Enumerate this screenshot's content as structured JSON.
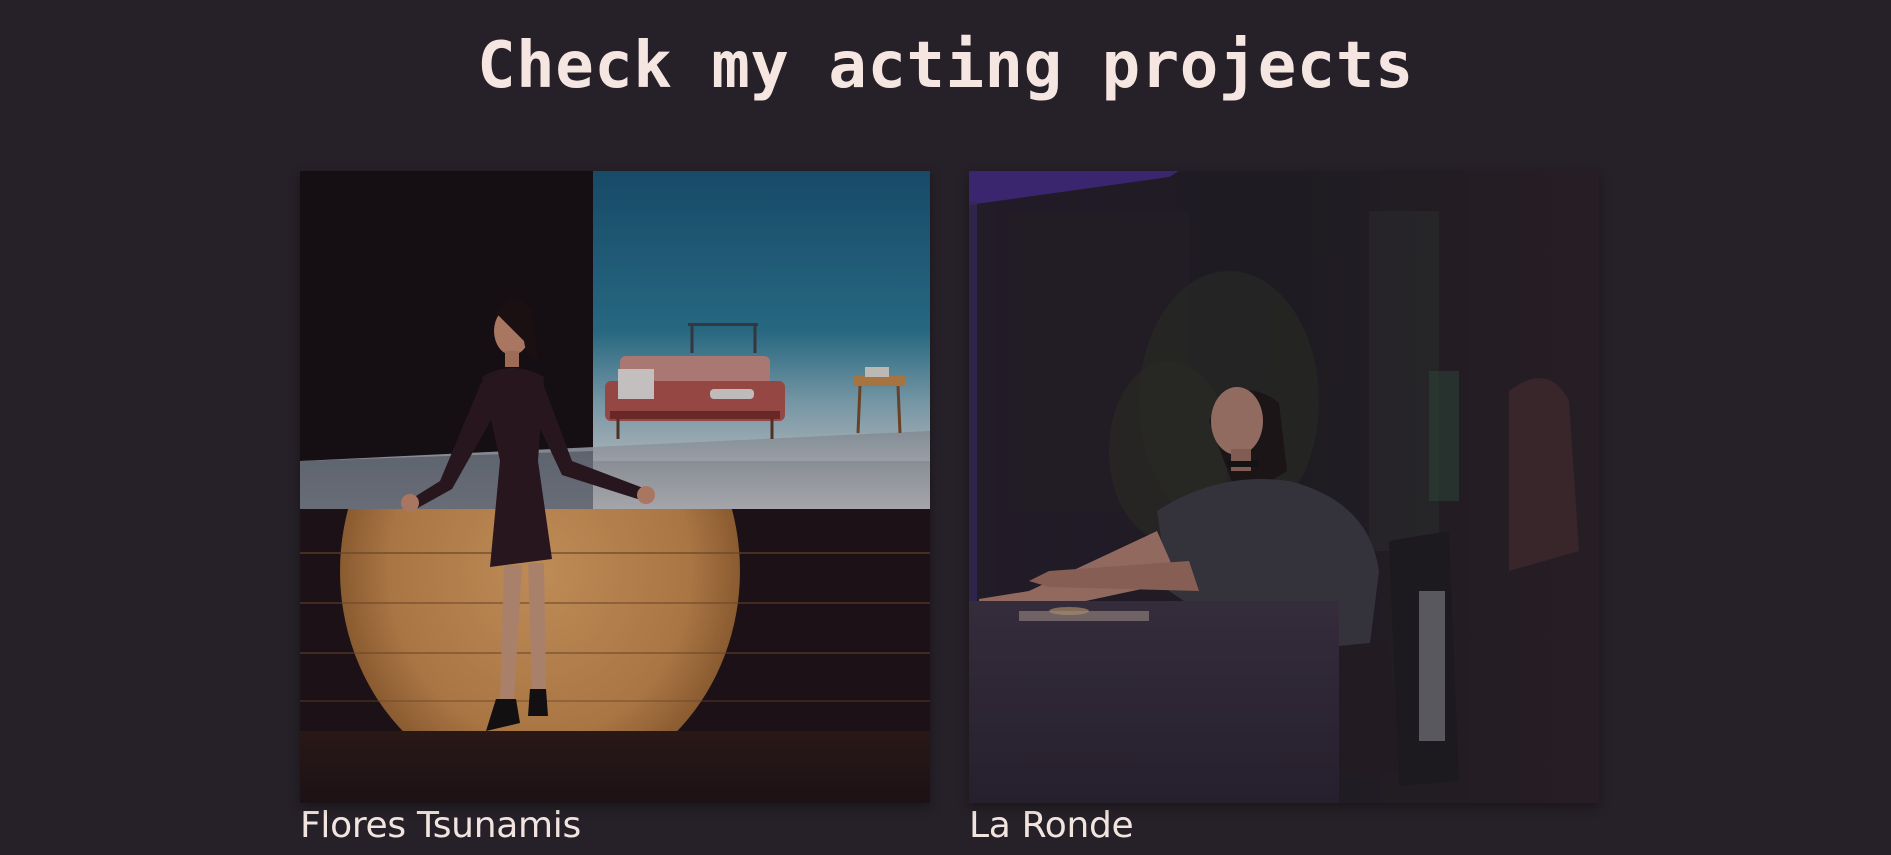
{
  "header": {
    "title": "Check my acting projects"
  },
  "projects": [
    {
      "title": "Flores Tsunamis"
    },
    {
      "title": "La Ronde"
    }
  ],
  "colors": {
    "background": "#262128",
    "text": "#f6e6e1"
  }
}
